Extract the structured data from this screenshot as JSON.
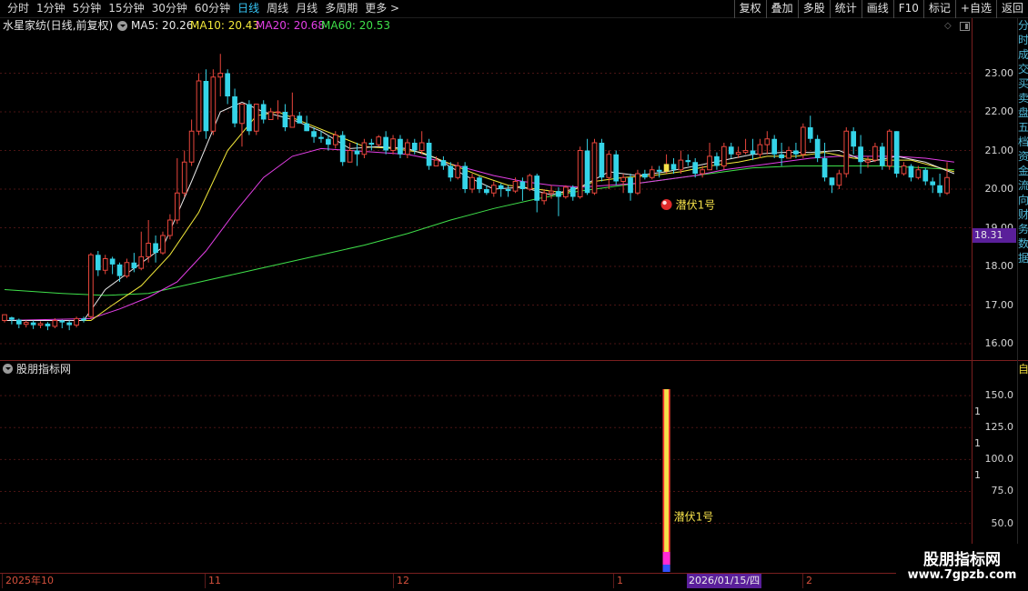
{
  "toolbar": {
    "period_tabs": [
      "分时",
      "1分钟",
      "5分钟",
      "15分钟",
      "30分钟",
      "60分钟",
      "日线",
      "周线",
      "月线",
      "多周期",
      "更多 >"
    ],
    "active_tab": "日线",
    "buttons": [
      "复权",
      "叠加",
      "多股",
      "统计",
      "画线",
      "F10",
      "标记",
      "+自选",
      "返回"
    ]
  },
  "info": {
    "title": "水星家纺(日线,前复权)",
    "ma5": "MA5: 20.26",
    "ma10": "MA10: 20.43",
    "ma20": "MA20: 20.68",
    "ma60": "MA60: 20.53"
  },
  "colors": {
    "up": "#e8463c",
    "down": "#35d4e8",
    "ma5": "#e8e8e8",
    "ma10": "#f3e93a",
    "ma20": "#e33fe6",
    "ma60": "#3fe04a",
    "frame": "#7a1f1f",
    "signal": "#f5e04a"
  },
  "price_axis": {
    "labels": [
      "23.00",
      "22.00",
      "21.00",
      "20.00",
      "19.00",
      "18.00",
      "17.00",
      "16.00"
    ],
    "current_price": "18.31"
  },
  "sub_panel": {
    "title": "股朋指标网",
    "axis_labels": [
      "150.0",
      "125.0",
      "100.0",
      "75.0",
      "50.0"
    ],
    "axis_short": [
      "1",
      "1",
      "1"
    ],
    "signal_label": "潜伏1号",
    "signal_value": 155
  },
  "signal_marker": {
    "label": "潜伏1号"
  },
  "dates": {
    "labels": [
      "2025年10",
      "11",
      "12",
      "1",
      "2"
    ],
    "cursor": "2026/01/15/四"
  },
  "right_strip": {
    "text": "分时成交买卖盘五档资金流向财务数据",
    "mark": "自"
  },
  "watermark": {
    "name": "股朋指标网",
    "url": "www.7gpzb.com"
  },
  "chart_data": {
    "type": "candlestick",
    "ylim": [
      15.6,
      24.0
    ],
    "candles": [
      [
        16.6,
        16.75,
        16.55,
        16.68
      ],
      [
        16.68,
        16.62,
        16.5,
        16.7
      ],
      [
        16.62,
        16.5,
        16.4,
        16.65
      ],
      [
        16.5,
        16.55,
        16.42,
        16.6
      ],
      [
        16.55,
        16.48,
        16.38,
        16.6
      ],
      [
        16.48,
        16.52,
        16.4,
        16.58
      ],
      [
        16.52,
        16.45,
        16.35,
        16.56
      ],
      [
        16.45,
        16.6,
        16.4,
        16.66
      ],
      [
        16.6,
        16.55,
        16.4,
        16.62
      ],
      [
        16.55,
        16.48,
        16.35,
        16.6
      ],
      [
        16.48,
        16.65,
        16.42,
        16.7
      ],
      [
        16.65,
        16.6,
        16.55,
        16.7
      ],
      [
        16.7,
        18.3,
        16.65,
        18.35
      ],
      [
        18.3,
        17.9,
        17.75,
        18.4
      ],
      [
        17.9,
        18.2,
        17.8,
        18.3
      ],
      [
        18.2,
        18.05,
        17.8,
        18.25
      ],
      [
        18.05,
        17.75,
        17.6,
        18.1
      ],
      [
        17.75,
        18.1,
        17.7,
        18.2
      ],
      [
        18.1,
        17.95,
        17.85,
        18.35
      ],
      [
        17.95,
        18.25,
        17.9,
        18.9
      ],
      [
        18.25,
        18.6,
        18.1,
        19.2
      ],
      [
        18.6,
        18.35,
        18.1,
        18.8
      ],
      [
        18.35,
        18.8,
        18.3,
        18.9
      ],
      [
        18.8,
        19.2,
        18.7,
        19.35
      ],
      [
        19.2,
        19.9,
        19.1,
        20.8
      ],
      [
        19.9,
        20.7,
        19.8,
        21.0
      ],
      [
        20.7,
        21.5,
        20.6,
        21.8
      ],
      [
        21.5,
        22.8,
        21.4,
        23.0
      ],
      [
        22.8,
        21.5,
        21.3,
        23.1
      ],
      [
        21.5,
        22.9,
        21.4,
        23.1
      ],
      [
        22.9,
        23.0,
        22.4,
        23.5
      ],
      [
        23.0,
        22.4,
        22.2,
        23.1
      ],
      [
        22.4,
        21.7,
        21.6,
        22.6
      ],
      [
        21.7,
        22.2,
        21.1,
        22.2
      ],
      [
        22.2,
        21.5,
        21.4,
        22.3
      ],
      [
        21.5,
        22.2,
        21.4,
        22.2
      ],
      [
        22.2,
        21.8,
        21.7,
        22.3
      ],
      [
        21.8,
        22.0,
        21.8,
        22.1
      ],
      [
        22.0,
        22.0,
        21.8,
        22.3
      ],
      [
        22.0,
        21.6,
        21.5,
        22.2
      ],
      [
        21.6,
        21.9,
        21.6,
        22.5
      ],
      [
        21.9,
        21.7,
        21.7,
        22.0
      ],
      [
        21.7,
        21.5,
        21.5,
        21.9
      ],
      [
        21.5,
        21.35,
        21.2,
        21.6
      ],
      [
        21.35,
        21.3,
        21.2,
        21.5
      ],
      [
        21.3,
        21.15,
        21.0,
        21.4
      ],
      [
        21.15,
        21.4,
        21.05,
        21.5
      ],
      [
        21.4,
        20.7,
        20.6,
        21.5
      ],
      [
        20.7,
        21.0,
        20.8,
        21.2
      ],
      [
        21.0,
        20.9,
        20.6,
        21.2
      ],
      [
        20.9,
        21.2,
        20.8,
        21.3
      ],
      [
        21.2,
        21.15,
        21.0,
        21.3
      ],
      [
        21.15,
        21.35,
        21.1,
        21.4
      ],
      [
        21.35,
        21.0,
        20.9,
        21.5
      ],
      [
        21.0,
        21.3,
        20.9,
        21.4
      ],
      [
        21.3,
        20.9,
        20.8,
        21.4
      ],
      [
        20.9,
        21.2,
        20.8,
        21.3
      ],
      [
        21.2,
        21.0,
        20.9,
        21.3
      ],
      [
        21.0,
        21.2,
        20.9,
        21.5
      ],
      [
        21.2,
        20.6,
        20.5,
        21.3
      ],
      [
        20.6,
        20.75,
        20.6,
        20.85
      ],
      [
        20.75,
        20.6,
        20.5,
        20.85
      ],
      [
        20.6,
        20.3,
        20.2,
        20.7
      ],
      [
        20.3,
        20.6,
        20.25,
        20.7
      ],
      [
        20.6,
        20.0,
        19.9,
        20.7
      ],
      [
        20.0,
        20.3,
        19.9,
        20.4
      ],
      [
        20.3,
        20.0,
        19.9,
        20.35
      ],
      [
        20.0,
        19.9,
        19.85,
        20.1
      ],
      [
        19.9,
        20.1,
        19.8,
        20.2
      ],
      [
        20.1,
        20.0,
        19.8,
        20.15
      ],
      [
        20.0,
        19.95,
        19.8,
        20.1
      ],
      [
        19.95,
        20.2,
        19.9,
        20.3
      ],
      [
        20.2,
        20.0,
        19.7,
        20.3
      ],
      [
        20.0,
        20.35,
        19.95,
        20.4
      ],
      [
        20.35,
        19.7,
        19.4,
        20.4
      ],
      [
        19.7,
        19.9,
        19.6,
        20.0
      ],
      [
        19.9,
        19.95,
        19.75,
        20.1
      ],
      [
        19.95,
        19.8,
        19.3,
        20.05
      ],
      [
        19.8,
        20.05,
        19.75,
        20.1
      ],
      [
        20.05,
        19.8,
        19.7,
        20.1
      ],
      [
        19.8,
        21.0,
        19.75,
        21.1
      ],
      [
        21.0,
        19.9,
        19.85,
        21.3
      ],
      [
        19.9,
        21.2,
        19.85,
        21.3
      ],
      [
        21.2,
        20.3,
        20.2,
        21.3
      ],
      [
        20.3,
        20.9,
        20.0,
        21.0
      ],
      [
        20.9,
        20.2,
        20.1,
        21.0
      ],
      [
        20.2,
        20.3,
        19.9,
        20.4
      ],
      [
        20.3,
        19.9,
        19.7,
        20.4
      ],
      [
        19.9,
        20.4,
        19.85,
        20.5
      ],
      [
        20.4,
        20.3,
        20.25,
        20.5
      ],
      [
        20.3,
        20.5,
        20.25,
        20.6
      ],
      [
        20.5,
        20.45,
        20.3,
        20.6
      ],
      [
        20.45,
        20.65,
        20.4,
        20.9
      ],
      [
        20.65,
        20.5,
        20.4,
        20.8
      ],
      [
        20.5,
        20.75,
        20.4,
        21.0
      ],
      [
        20.75,
        20.7,
        20.6,
        20.9
      ],
      [
        20.7,
        20.4,
        20.3,
        20.8
      ],
      [
        20.4,
        20.5,
        20.3,
        20.6
      ],
      [
        20.5,
        20.85,
        20.5,
        21.2
      ],
      [
        20.85,
        20.6,
        20.5,
        20.95
      ],
      [
        20.6,
        21.1,
        20.5,
        21.2
      ],
      [
        21.1,
        20.9,
        20.8,
        21.2
      ],
      [
        20.9,
        20.95,
        20.8,
        21.1
      ],
      [
        20.95,
        21.0,
        20.9,
        21.3
      ],
      [
        21.0,
        20.9,
        20.75,
        21.3
      ],
      [
        20.9,
        21.15,
        20.8,
        21.3
      ],
      [
        21.15,
        21.3,
        20.9,
        21.5
      ],
      [
        21.3,
        20.9,
        20.8,
        21.4
      ],
      [
        20.9,
        20.8,
        20.6,
        21.2
      ],
      [
        20.8,
        21.0,
        20.8,
        21.1
      ],
      [
        21.0,
        20.9,
        20.8,
        21.2
      ],
      [
        20.9,
        21.6,
        20.8,
        21.7
      ],
      [
        21.6,
        21.3,
        21.2,
        21.9
      ],
      [
        21.3,
        20.8,
        20.7,
        21.4
      ],
      [
        20.8,
        20.3,
        20.2,
        21.2
      ],
      [
        20.3,
        20.1,
        19.9,
        20.3
      ],
      [
        20.1,
        20.4,
        20.0,
        20.5
      ],
      [
        20.4,
        21.5,
        20.3,
        21.6
      ],
      [
        21.5,
        21.1,
        20.9,
        21.6
      ],
      [
        21.1,
        20.7,
        20.4,
        21.4
      ],
      [
        20.7,
        20.75,
        20.55,
        20.85
      ],
      [
        20.75,
        21.1,
        20.7,
        21.2
      ],
      [
        21.1,
        20.6,
        20.5,
        21.2
      ],
      [
        20.6,
        21.5,
        20.5,
        21.55
      ],
      [
        21.5,
        20.4,
        20.3,
        21.5
      ],
      [
        20.4,
        20.6,
        20.35,
        20.7
      ],
      [
        20.6,
        20.3,
        20.2,
        20.65
      ],
      [
        20.3,
        20.5,
        20.25,
        20.6
      ],
      [
        20.5,
        20.2,
        20.1,
        20.55
      ],
      [
        20.2,
        20.1,
        19.9,
        20.3
      ],
      [
        20.1,
        19.9,
        19.8,
        20.4
      ],
      [
        19.9,
        20.3,
        19.85,
        20.7
      ]
    ],
    "ma_lines": {
      "MA5": [
        [
          0,
          16.6
        ],
        [
          11,
          16.6
        ],
        [
          14,
          17.4
        ],
        [
          18,
          17.95
        ],
        [
          22,
          18.5
        ],
        [
          26,
          20.2
        ],
        [
          30,
          22.0
        ],
        [
          33,
          22.25
        ],
        [
          36,
          22.0
        ],
        [
          40,
          21.8
        ],
        [
          44,
          21.5
        ],
        [
          48,
          21.05
        ],
        [
          52,
          21.1
        ],
        [
          56,
          21.05
        ],
        [
          60,
          20.8
        ],
        [
          64,
          20.35
        ],
        [
          68,
          20.0
        ],
        [
          72,
          20.05
        ],
        [
          76,
          19.85
        ],
        [
          80,
          20.05
        ],
        [
          84,
          20.45
        ],
        [
          88,
          20.35
        ],
        [
          92,
          20.45
        ],
        [
          96,
          20.6
        ],
        [
          100,
          20.75
        ],
        [
          104,
          20.9
        ],
        [
          108,
          20.95
        ],
        [
          112,
          20.95
        ],
        [
          116,
          21.0
        ],
        [
          120,
          20.7
        ],
        [
          124,
          20.85
        ],
        [
          128,
          20.7
        ],
        [
          132,
          20.4
        ]
      ],
      "MA10": [
        [
          0,
          16.6
        ],
        [
          12,
          16.6
        ],
        [
          15,
          17.0
        ],
        [
          19,
          17.5
        ],
        [
          23,
          18.3
        ],
        [
          27,
          19.4
        ],
        [
          31,
          21.0
        ],
        [
          35,
          21.9
        ],
        [
          38,
          22.0
        ],
        [
          42,
          21.7
        ],
        [
          46,
          21.4
        ],
        [
          50,
          21.1
        ],
        [
          54,
          21.05
        ],
        [
          58,
          20.95
        ],
        [
          62,
          20.65
        ],
        [
          66,
          20.35
        ],
        [
          70,
          20.1
        ],
        [
          74,
          20.0
        ],
        [
          78,
          19.9
        ],
        [
          82,
          20.2
        ],
        [
          86,
          20.3
        ],
        [
          90,
          20.35
        ],
        [
          94,
          20.45
        ],
        [
          98,
          20.6
        ],
        [
          102,
          20.7
        ],
        [
          106,
          20.85
        ],
        [
          110,
          20.85
        ],
        [
          114,
          20.95
        ],
        [
          118,
          20.8
        ],
        [
          122,
          20.75
        ],
        [
          126,
          20.75
        ],
        [
          130,
          20.55
        ],
        [
          132,
          20.45
        ]
      ],
      "MA20": [
        [
          0,
          16.6
        ],
        [
          12,
          16.65
        ],
        [
          16,
          16.9
        ],
        [
          20,
          17.2
        ],
        [
          24,
          17.6
        ],
        [
          28,
          18.4
        ],
        [
          32,
          19.4
        ],
        [
          36,
          20.3
        ],
        [
          40,
          20.85
        ],
        [
          44,
          21.05
        ],
        [
          48,
          21.0
        ],
        [
          52,
          20.95
        ],
        [
          56,
          20.9
        ],
        [
          60,
          20.75
        ],
        [
          64,
          20.55
        ],
        [
          68,
          20.35
        ],
        [
          72,
          20.2
        ],
        [
          76,
          20.1
        ],
        [
          80,
          20.05
        ],
        [
          84,
          20.1
        ],
        [
          88,
          20.15
        ],
        [
          92,
          20.25
        ],
        [
          96,
          20.35
        ],
        [
          100,
          20.5
        ],
        [
          104,
          20.6
        ],
        [
          108,
          20.7
        ],
        [
          112,
          20.8
        ],
        [
          116,
          20.85
        ],
        [
          120,
          20.85
        ],
        [
          124,
          20.85
        ],
        [
          128,
          20.8
        ],
        [
          132,
          20.7
        ]
      ],
      "MA60": [
        [
          0,
          17.4
        ],
        [
          8,
          17.3
        ],
        [
          14,
          17.25
        ],
        [
          20,
          17.3
        ],
        [
          26,
          17.55
        ],
        [
          32,
          17.8
        ],
        [
          38,
          18.05
        ],
        [
          44,
          18.3
        ],
        [
          50,
          18.55
        ],
        [
          56,
          18.85
        ],
        [
          62,
          19.2
        ],
        [
          68,
          19.5
        ],
        [
          74,
          19.75
        ],
        [
          80,
          19.95
        ],
        [
          86,
          20.1
        ],
        [
          92,
          20.25
        ],
        [
          98,
          20.4
        ],
        [
          104,
          20.55
        ],
        [
          110,
          20.6
        ],
        [
          116,
          20.6
        ],
        [
          122,
          20.6
        ],
        [
          128,
          20.55
        ],
        [
          132,
          20.5
        ]
      ]
    },
    "signal_index": 92,
    "signal_price": 19.6
  }
}
